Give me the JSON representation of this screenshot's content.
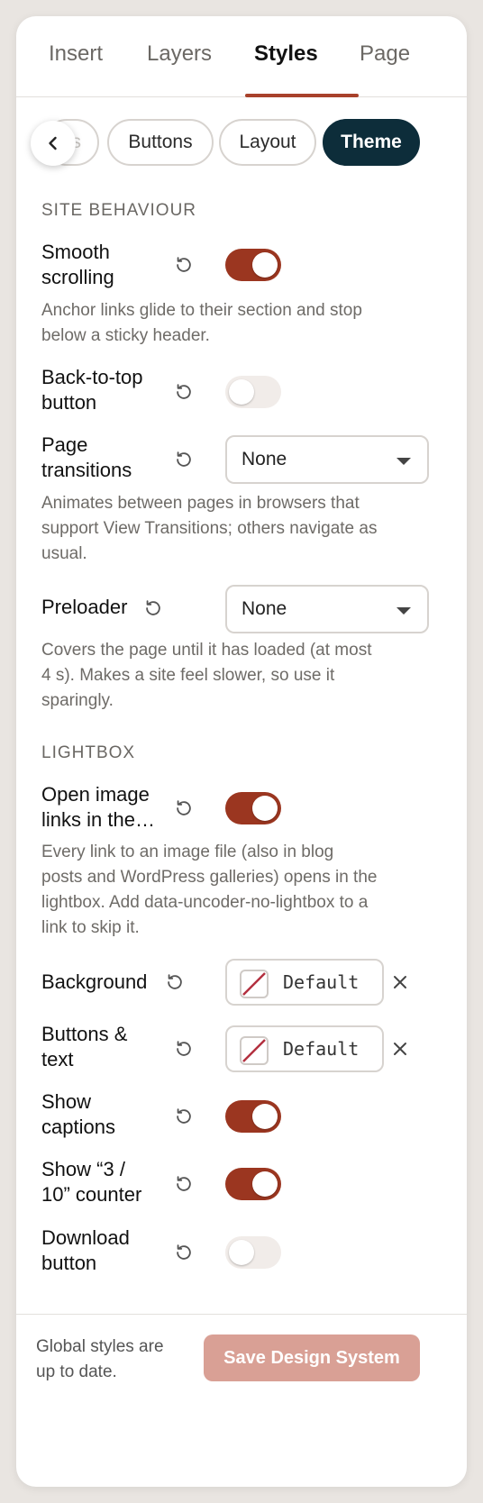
{
  "tabs": [
    "Insert",
    "Layers",
    "Styles",
    "Page"
  ],
  "active_tab": "Styles",
  "subtabs": {
    "partial": "s",
    "buttons": "Buttons",
    "layout": "Layout",
    "theme": "Theme"
  },
  "site_behaviour": {
    "title": "SITE BEHAVIOUR",
    "smooth_scrolling": {
      "label_1": "Smooth",
      "label_2": "scrolling",
      "on": true,
      "desc_1": "Anchor links glide to their section and stop",
      "desc_2": "below a sticky header."
    },
    "back_to_top": {
      "label_1": "Back-to-top",
      "label_2": "button",
      "on": false
    },
    "page_transitions": {
      "label_1": "Page",
      "label_2": "transitions",
      "value": "None",
      "desc_1": "Animates between pages in browsers that",
      "desc_2": "support View Transitions; others navigate as",
      "desc_3": "usual."
    },
    "preloader": {
      "label": "Preloader",
      "value": "None",
      "desc_1": "Covers the page until it has loaded (at most",
      "desc_2": "4 s). Makes a site feel slower, so use it",
      "desc_3": "sparingly."
    }
  },
  "lightbox": {
    "title": "LIGHTBOX",
    "open_image_links": {
      "label_1": "Open image",
      "label_2": "links in the…",
      "on": true,
      "desc_1": "Every link to an image file (also in blog",
      "desc_2": "posts and WordPress galleries) opens in the",
      "desc_3": "lightbox. Add data-uncoder-no-lightbox to a",
      "desc_4": "link to skip it."
    },
    "background": {
      "label": "Background",
      "value": "Default"
    },
    "buttons_text": {
      "label_1": "Buttons &",
      "label_2": "text",
      "value": "Default"
    },
    "show_captions": {
      "label_1": "Show",
      "label_2": "captions",
      "on": true
    },
    "show_counter": {
      "label_1": "Show “3 /",
      "label_2": "10” counter",
      "on": true
    },
    "download_button": {
      "label_1": "Download",
      "label_2": "button",
      "on": false
    }
  },
  "footer": {
    "status_1": "Global styles are",
    "status_2": "up to date.",
    "save_label": "Save Design System"
  },
  "colors": {
    "accent": "#9b3620",
    "dark": "#0d2d3a",
    "save_disabled": "#d9a095"
  }
}
